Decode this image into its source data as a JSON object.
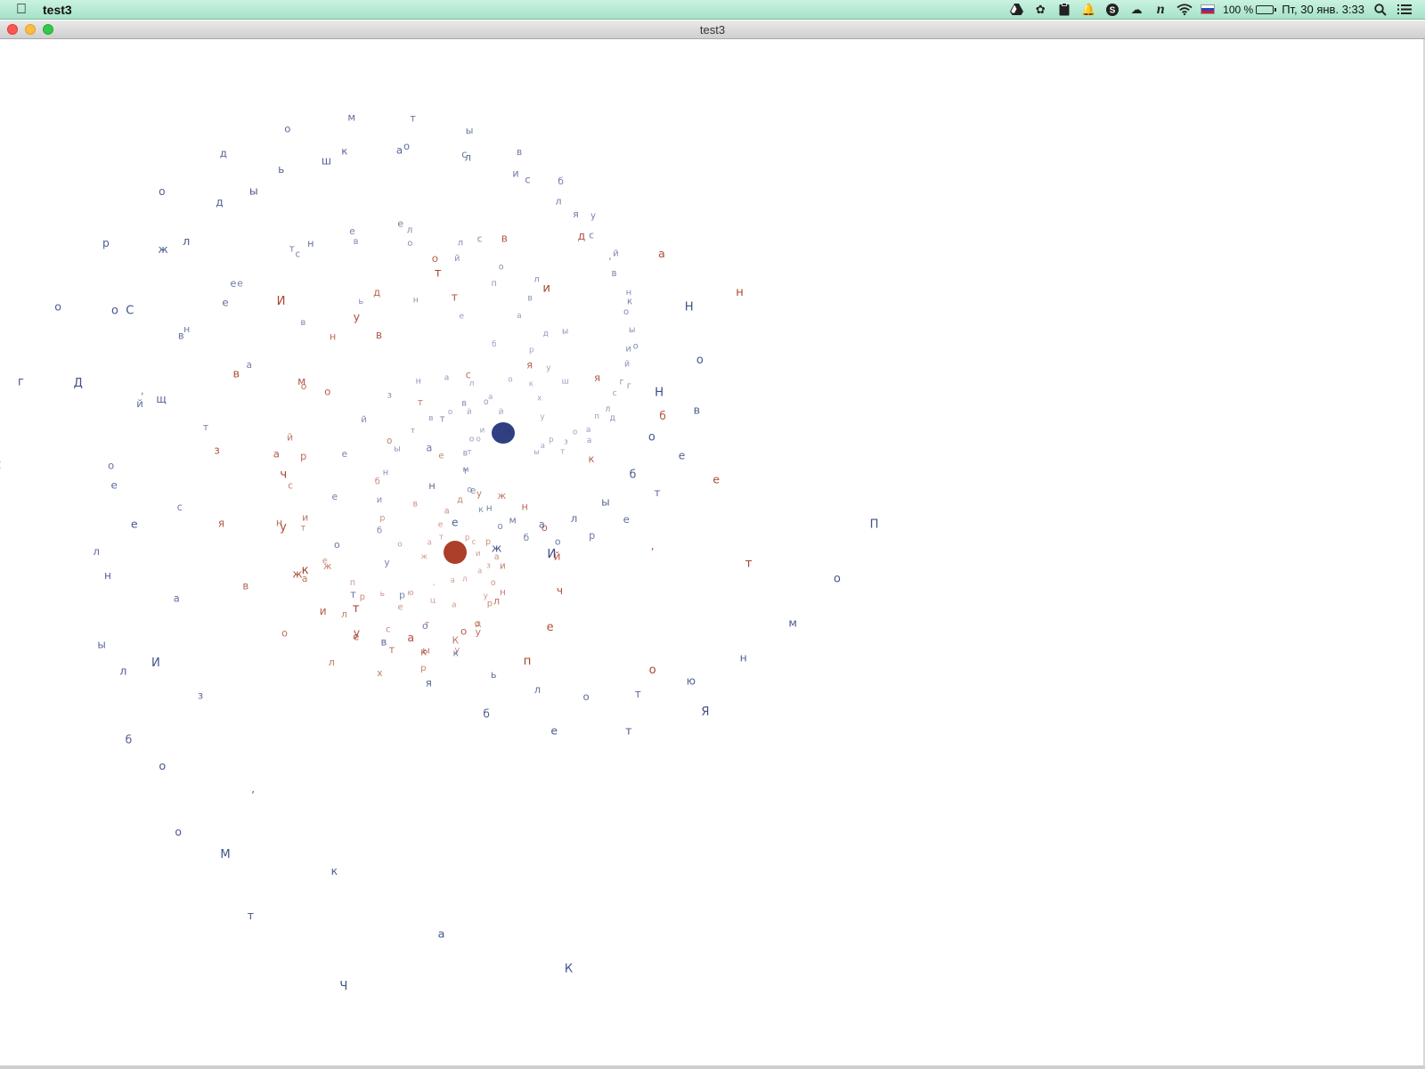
{
  "menubar": {
    "apple_icon": "apple-logo-icon",
    "app_name": "test3",
    "battery_percent": "100 %",
    "datetime": "Пт, 30 янв.  3:33",
    "icons": [
      "google-drive-icon",
      "paw-icon",
      "clipboard-icon",
      "bell-icon",
      "skype-icon",
      "cloud-icon",
      "n-icon",
      "wifi-icon",
      "flag-ru-icon",
      "battery-icon",
      "spotlight-search-icon",
      "notification-list-icon"
    ]
  },
  "window": {
    "title": "test3"
  },
  "colors": {
    "blue": "#3a4b86",
    "red": "#a8412a",
    "background": "#ffffff"
  },
  "poems": {
    "blue": [
      "Слышался, когда ты",
      "Дождь косил свои глаза",
      "С городом ты в буйный спор",
      "И еще не слышу",
      "Молней ветелло в дух",
      "Что было, не свой парк",
      "Как, заставь небо",
      "Я тебя в тоеей знала",
      "Помню только рубины твой",
      "Но была мне твои",
      "Но ветер обо ком то",
      "И жена твой"
    ],
    "red": [
      "над водной степью,",
      "туман ал стал",
      "И взявол хрудуа",
      "чужие ты Ко рози",
      "и твори жреца",
      "тебя ястоб рож",
      "о, киева",
      "печ йонжу дает",
      "тао ли рр",
      "кукуна с"
    ]
  }
}
